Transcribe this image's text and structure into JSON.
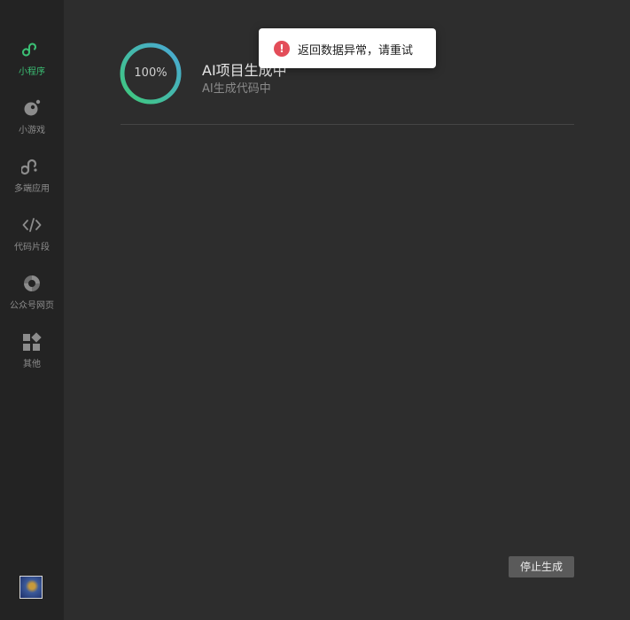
{
  "sidebar": {
    "items": [
      {
        "label": "小程序",
        "icon": "mini-program-icon",
        "active": true
      },
      {
        "label": "小游戏",
        "icon": "mini-game-icon",
        "active": false
      },
      {
        "label": "多端应用",
        "icon": "multi-platform-icon",
        "active": false
      },
      {
        "label": "代码片段",
        "icon": "code-snippet-icon",
        "active": false
      },
      {
        "label": "公众号网页",
        "icon": "official-account-icon",
        "active": false
      },
      {
        "label": "其他",
        "icon": "other-icon",
        "active": false
      }
    ],
    "avatar_icon": "avatar"
  },
  "progress": {
    "percent_text": "100%",
    "percent": 100,
    "title": "AI项目生成中",
    "subtitle": "AI生成代码中"
  },
  "toast": {
    "message": "返回数据异常，请重试",
    "icon": "error-icon",
    "icon_glyph": "!"
  },
  "actions": {
    "stop_label": "停止生成"
  },
  "colors": {
    "accent": "#3bbf74",
    "error": "#e34d59",
    "background": "#2d2d2d",
    "sidebar": "#232323"
  }
}
